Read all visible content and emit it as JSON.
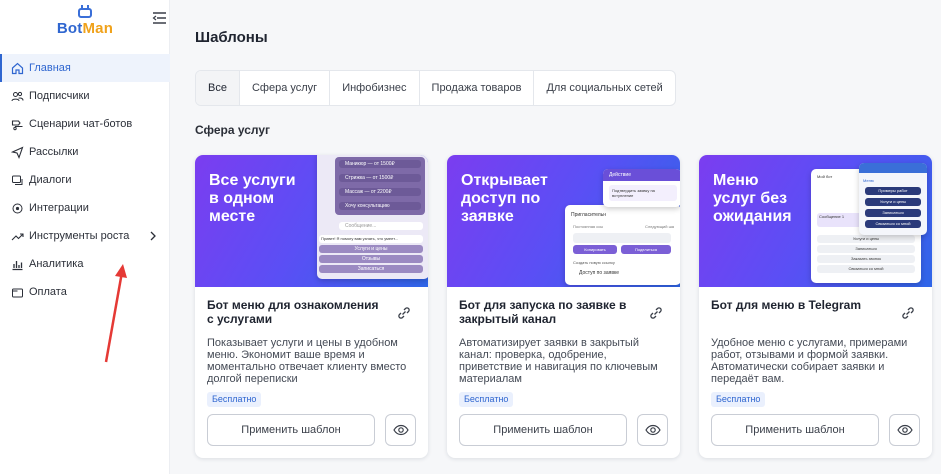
{
  "logo": {
    "part1": "Bot",
    "part2": "Man"
  },
  "nav": [
    {
      "label": "Главная",
      "icon": "home-icon",
      "active": true
    },
    {
      "label": "Подписчики",
      "icon": "users-icon"
    },
    {
      "label": "Сценарии чат-ботов",
      "icon": "scenario-icon"
    },
    {
      "label": "Рассылки",
      "icon": "send-icon"
    },
    {
      "label": "Диалоги",
      "icon": "dialogs-icon"
    },
    {
      "label": "Интеграции",
      "icon": "integrations-icon"
    },
    {
      "label": "Инструменты роста",
      "icon": "growth-icon",
      "chevron": true
    },
    {
      "label": "Аналитика",
      "icon": "analytics-icon"
    },
    {
      "label": "Оплата",
      "icon": "payment-icon"
    }
  ],
  "page_title": "Шаблоны",
  "tabs": [
    "Все",
    "Сфера услуг",
    "Инфобизнес",
    "Продажа товаров",
    "Для социальных сетей"
  ],
  "section_title": "Сфера услуг",
  "cards": [
    {
      "banner": "Все услуги\nв одном\nместе",
      "title": "Бот меню для ознакомления с услугами",
      "desc": "Показывает услуги и цены в удобном меню. Экономит ваше время и моментально отвечает клиенту вместо долгой переписки",
      "badge": "Бесплатно",
      "apply": "Применить шаблон",
      "mock": [
        "Маникюр — от 1500₽",
        "Стрижка — от 1500₽",
        "Массаж — от 2200₽",
        "Хочу консультацию",
        "Сообщение...",
        "Привет! Я помогу вам узнать, что умеет...",
        "Услуги и цены",
        "Отзывы",
        "Записаться",
        "Сообщение..."
      ]
    },
    {
      "banner": "Открывает\nдоступ по\nзаявке",
      "title": "Бот для запуска по заявке в закрытый канал",
      "desc": "Автоматизирует заявки в закрытый канал: проверка, одобрение, приветствие и навигация по ключевым материалам",
      "badge": "Бесплатно",
      "apply": "Применить шаблон",
      "mock": [
        "Действие",
        "Подтвердить заявку на вступление",
        "Пригласительн",
        "Постоянная ссы",
        "Следующий ша",
        "Копировать",
        "Поделиться",
        "Создать новую ссылку",
        "Доступ по заявке",
        "Ссылка в канале"
      ]
    },
    {
      "banner": "Меню\nуслуг без\nожидания",
      "title": "Бот для меню в Telegram",
      "desc": "Удобное меню с услугами, примерами работ, отзывами и формой заявки. Автоматически собирает заявки и передаёт вам.",
      "badge": "Бесплатно",
      "apply": "Применить шаблон",
      "mock": [
        "Мой бот",
        "Сообщение 1",
        "Меню",
        "Примеры работ",
        "Услуги и цены",
        "Записаться",
        "Связаться со мной",
        "Услуги и цены",
        "Заказать звонок",
        "Связаться со мной"
      ]
    }
  ],
  "colors": {
    "accent": "#2f66d0",
    "logo_orange": "#f0a21b",
    "annotation_arrow": "#e53935"
  }
}
